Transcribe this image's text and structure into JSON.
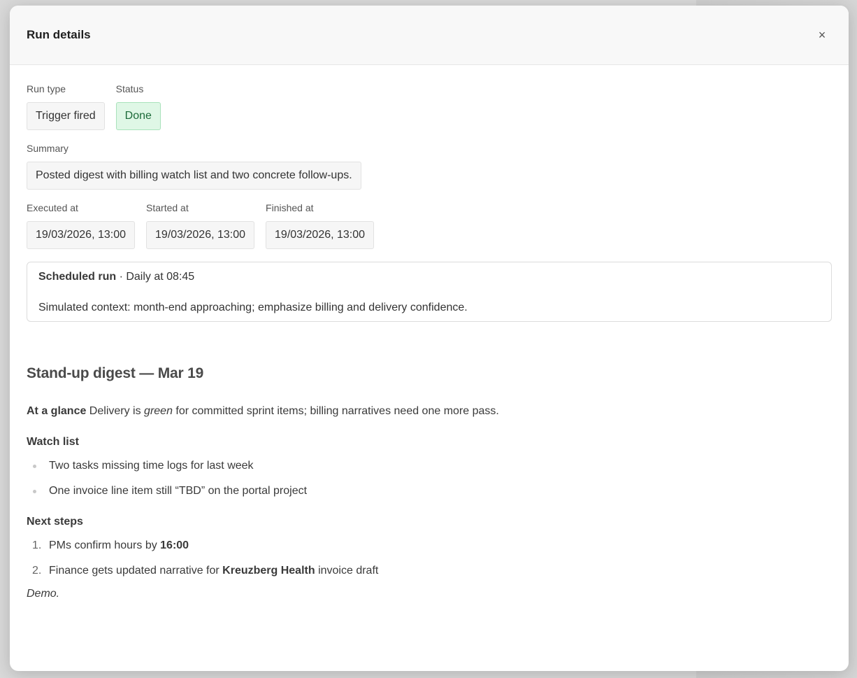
{
  "modal": {
    "title": "Run details",
    "close_label": "×"
  },
  "fields": {
    "run_type": {
      "label": "Run type",
      "value": "Trigger fired"
    },
    "status": {
      "label": "Status",
      "value": "Done"
    },
    "summary": {
      "label": "Summary",
      "value": "Posted digest with billing watch list and two concrete follow-ups."
    },
    "executed_at": {
      "label": "Executed at",
      "value": "19/03/2026, 13:00"
    },
    "started_at": {
      "label": "Started at",
      "value": "19/03/2026, 13:00"
    },
    "finished_at": {
      "label": "Finished at",
      "value": "19/03/2026, 13:00"
    }
  },
  "schedule": {
    "kind": "Scheduled run",
    "separator": " · ",
    "cadence": "Daily at 08:45",
    "context": "Simulated context: month-end approaching; emphasize billing and delivery confidence."
  },
  "digest": {
    "title": "Stand-up digest — Mar 19",
    "glance_label": "At a glance",
    "glance_pre": " Delivery is ",
    "glance_em": "green",
    "glance_post": " for committed sprint items; billing narratives need one more pass.",
    "watch_label": "Watch list",
    "watch_items": [
      "Two tasks missing time logs for last week",
      "One invoice line item still “TBD” on the portal project"
    ],
    "next_label": "Next steps",
    "steps": [
      {
        "num": "1.",
        "pre": "PMs confirm hours by ",
        "bold": "16:00",
        "post": ""
      },
      {
        "num": "2.",
        "pre": "Finance gets updated narrative for ",
        "bold": "Kreuzberg Health",
        "post": " invoice draft"
      }
    ],
    "footer": "Demo."
  },
  "colors": {
    "status_done_bg": "#dff7e6",
    "status_done_text": "#1d6b3a"
  }
}
